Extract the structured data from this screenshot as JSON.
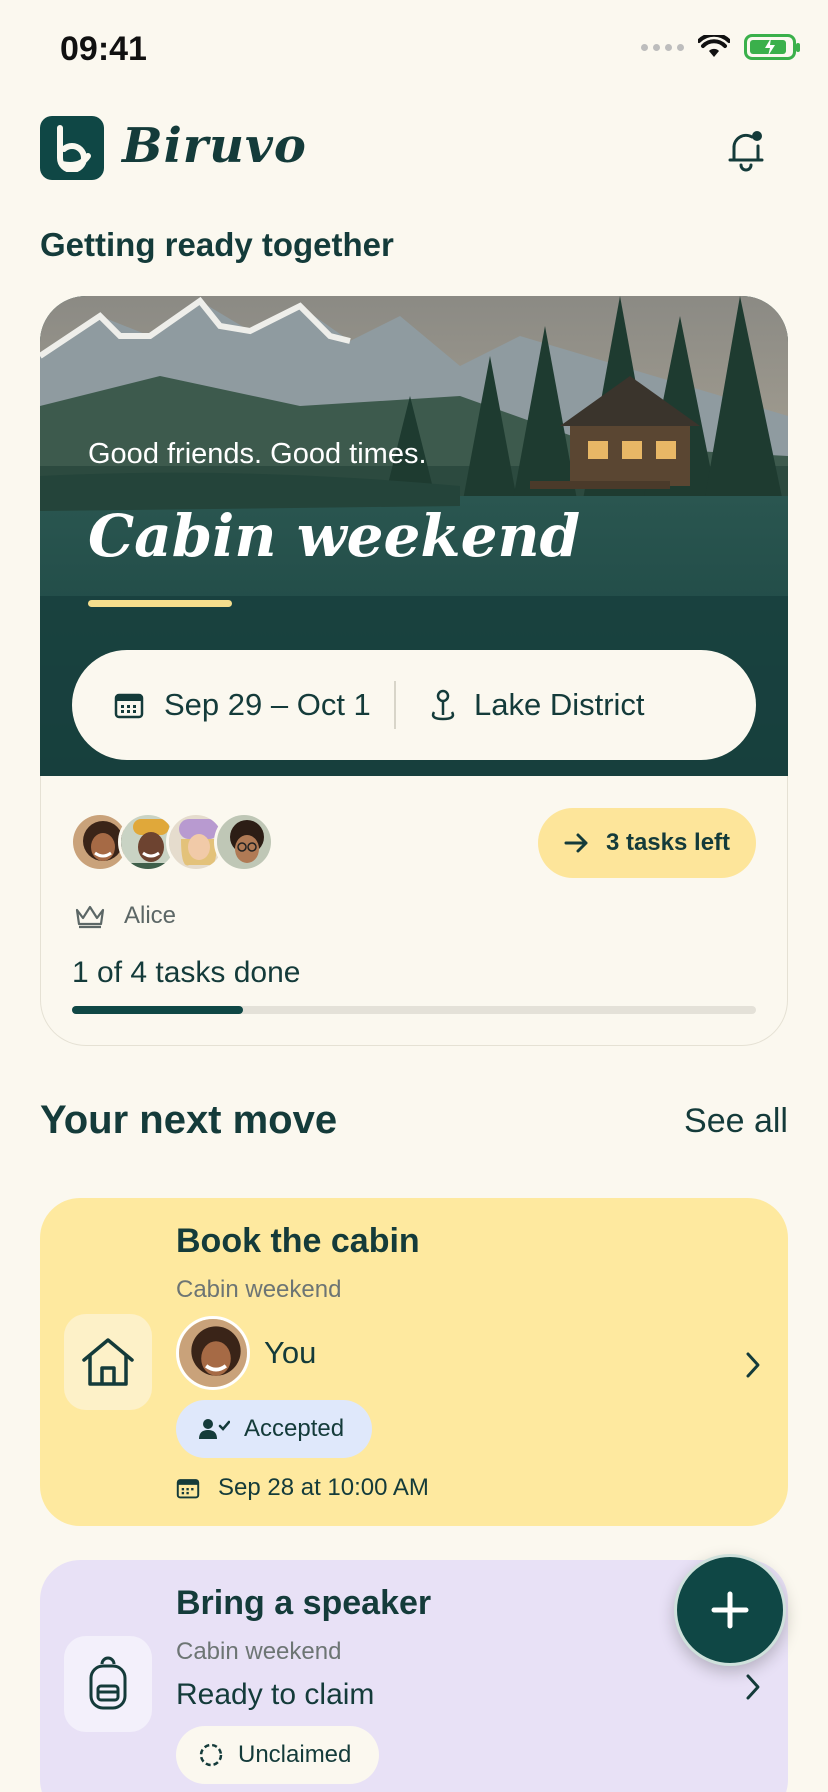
{
  "status_bar": {
    "time": "09:41"
  },
  "app": {
    "brand": "Biruvo"
  },
  "header": {
    "subtitle": "Getting ready together"
  },
  "trip": {
    "tagline": "Good friends. Good times.",
    "title": "Cabin weekend",
    "dates": "Sep 29 – Oct 1",
    "location": "Lake District",
    "owner": "Alice",
    "tasks_left_label": "3 tasks left",
    "progress_label": "1 of 4 tasks done",
    "progress_fraction": 0.25,
    "members": [
      "member-1",
      "member-2",
      "member-3",
      "member-4"
    ]
  },
  "next_moves": {
    "title": "Your next move",
    "see_all": "See all",
    "tasks": [
      {
        "title": "Book the cabin",
        "trip": "Cabin weekend",
        "assignee": "You",
        "status": "Accepted",
        "due": "Sep 28 at 10:00 AM",
        "icon": "house-icon",
        "color": "#fee99f"
      },
      {
        "title": "Bring a speaker",
        "trip": "Cabin weekend",
        "state_text": "Ready to claim",
        "status": "Unclaimed",
        "icon": "backpack-icon",
        "color": "#e8e1f6"
      }
    ]
  },
  "colors": {
    "accent": "#0f4745",
    "background": "#fbf8ef",
    "highlight": "#fde59a"
  }
}
